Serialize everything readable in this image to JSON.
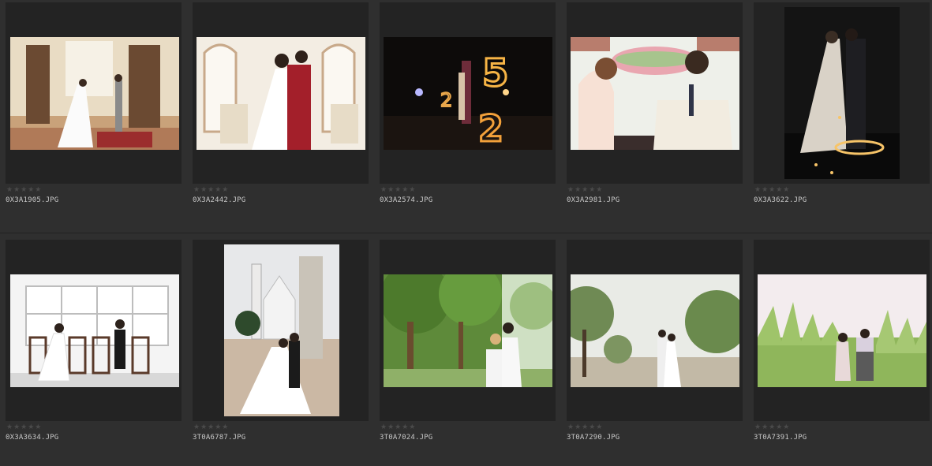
{
  "grid": {
    "rows": [
      {
        "items": [
          {
            "filename": "0X3A1905.JPG",
            "rating": "★★★★★",
            "thumbnail": "wedding-couple-vintage-room-photo"
          },
          {
            "filename": "0X3A2442.JPG",
            "rating": "★★★★★",
            "thumbnail": "wedding-couple-red-suit-photo"
          },
          {
            "filename": "0X3A2574.JPG",
            "rating": "★★★★★",
            "thumbnail": "wedding-couple-night-lights-photo"
          },
          {
            "filename": "0X3A2981.JPG",
            "rating": "★★★★★",
            "thumbnail": "wedding-couple-tea-table-photo"
          },
          {
            "filename": "0X3A3622.JPG",
            "rating": "★★★★★",
            "thumbnail": "wedding-couple-fairy-lights-photo"
          }
        ]
      },
      {
        "items": [
          {
            "filename": "0X3A3634.JPG",
            "rating": "★★★★★",
            "thumbnail": "wedding-couple-chairs-window-photo"
          },
          {
            "filename": "3T0A6787.JPG",
            "rating": "★★★★★",
            "thumbnail": "wedding-couple-church-photo"
          },
          {
            "filename": "3T0A7024.JPG",
            "rating": "★★★★★",
            "thumbnail": "wedding-couple-forest-photo"
          },
          {
            "filename": "3T0A7290.JPG",
            "rating": "★★★★★",
            "thumbnail": "wedding-couple-field-trees-photo"
          },
          {
            "filename": "3T0A7391.JPG",
            "rating": "★★★★★",
            "thumbnail": "wedding-couple-tall-grass-photo"
          }
        ]
      }
    ]
  },
  "colors": {
    "background": "#2a2a2a",
    "cell": "#2f2f2f",
    "frame": "#232323",
    "text": "#c8c8c8",
    "stars": "#4a4a4a"
  }
}
